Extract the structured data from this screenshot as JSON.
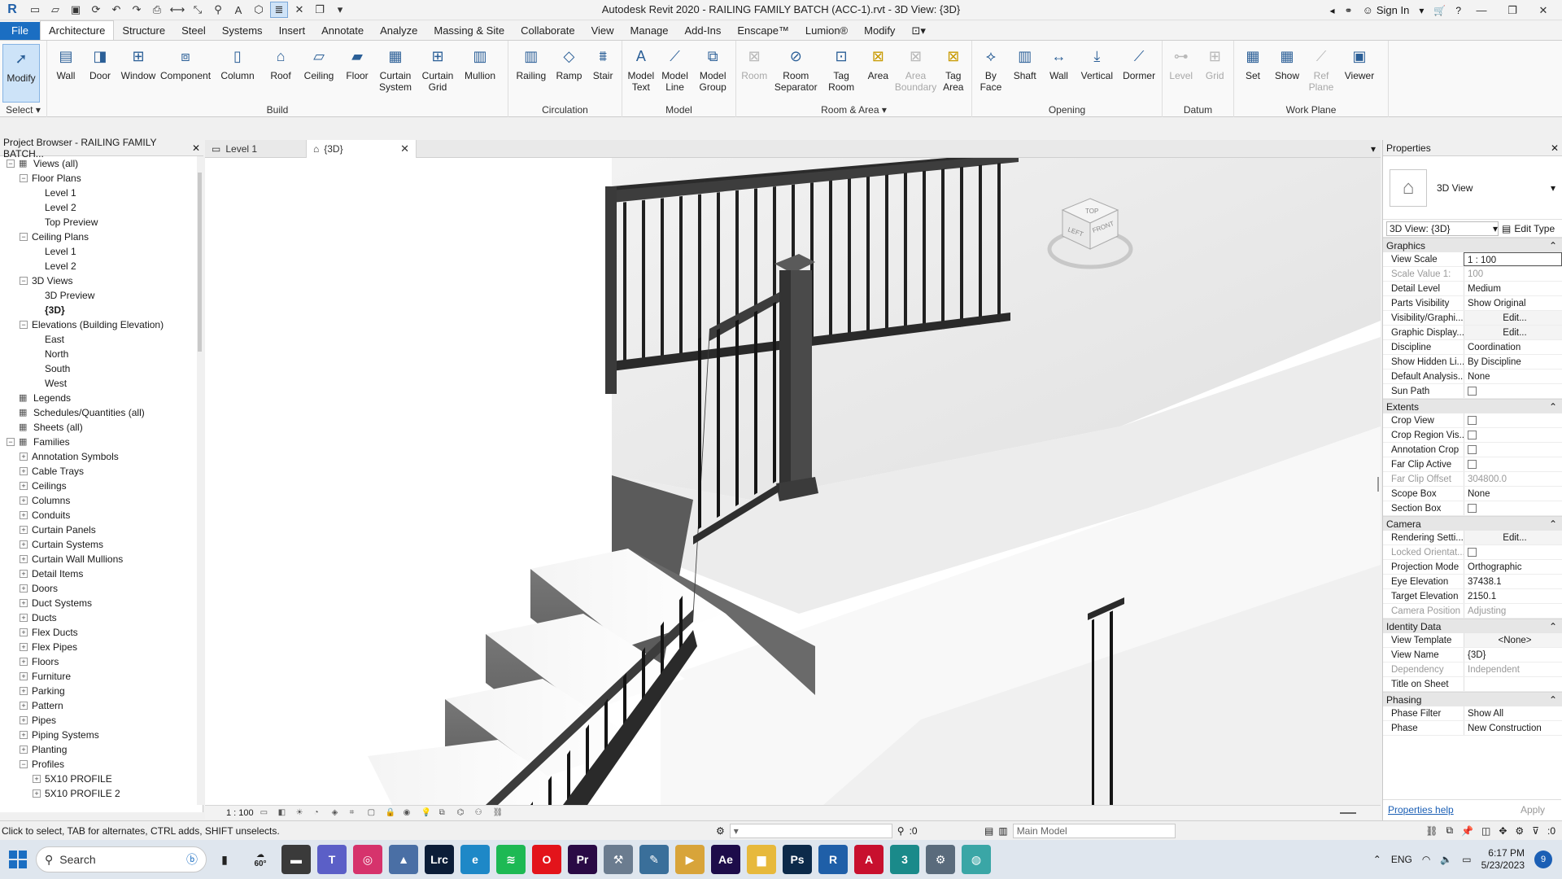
{
  "app": {
    "title": "Autodesk Revit 2020 - RAILING FAMILY BATCH (ACC-1).rvt - 3D View: {3D}",
    "sign_in": "Sign In"
  },
  "ribbon_tabs": [
    "File",
    "Architecture",
    "Structure",
    "Steel",
    "Systems",
    "Insert",
    "Annotate",
    "Analyze",
    "Massing & Site",
    "Collaborate",
    "View",
    "Manage",
    "Add-Ins",
    "Enscape™",
    "Lumion®",
    "Modify"
  ],
  "ribbon": {
    "select": {
      "modify": "Modify",
      "title": "Select"
    },
    "build": {
      "title": "Build",
      "buttons": [
        "Wall",
        "Door",
        "Window",
        "Component",
        "Column",
        "Roof",
        "Ceiling",
        "Floor",
        "Curtain System",
        "Curtain Grid",
        "Mullion"
      ]
    },
    "circulation": {
      "title": "Circulation",
      "buttons": [
        "Railing",
        "Ramp",
        "Stair"
      ]
    },
    "model": {
      "title": "Model",
      "buttons": [
        "Model Text",
        "Model Line",
        "Model Group"
      ]
    },
    "room_area": {
      "title": "Room & Area",
      "buttons": [
        "Room",
        "Room Separator",
        "Tag Room",
        "Area",
        "Area Boundary",
        "Tag Area"
      ]
    },
    "opening": {
      "title": "Opening",
      "buttons": [
        "By Face",
        "Shaft",
        "Wall",
        "Vertical",
        "Dormer"
      ]
    },
    "datum": {
      "title": "Datum",
      "buttons": [
        "Level",
        "Grid"
      ]
    },
    "work_plane": {
      "title": "Work Plane",
      "buttons": [
        "Set",
        "Show",
        "Ref Plane",
        "Viewer"
      ]
    }
  },
  "project_browser": {
    "title": "Project Browser - RAILING FAMILY BATCH...",
    "tree": [
      {
        "label": "Views (all)",
        "level": 0,
        "exp": "−",
        "icon": "view-icon"
      },
      {
        "label": "Floor Plans",
        "level": 1,
        "exp": "−"
      },
      {
        "label": "Level 1",
        "level": 2,
        "exp": ""
      },
      {
        "label": "Level 2",
        "level": 2,
        "exp": ""
      },
      {
        "label": "Top Preview",
        "level": 2,
        "exp": ""
      },
      {
        "label": "Ceiling Plans",
        "level": 1,
        "exp": "−"
      },
      {
        "label": "Level 1",
        "level": 2,
        "exp": ""
      },
      {
        "label": "Level 2",
        "level": 2,
        "exp": ""
      },
      {
        "label": "3D Views",
        "level": 1,
        "exp": "−"
      },
      {
        "label": "3D Preview",
        "level": 2,
        "exp": ""
      },
      {
        "label": "{3D}",
        "level": 2,
        "exp": "",
        "bold": true
      },
      {
        "label": "Elevations (Building Elevation)",
        "level": 1,
        "exp": "−"
      },
      {
        "label": "East",
        "level": 2,
        "exp": ""
      },
      {
        "label": "North",
        "level": 2,
        "exp": ""
      },
      {
        "label": "South",
        "level": 2,
        "exp": ""
      },
      {
        "label": "West",
        "level": 2,
        "exp": ""
      },
      {
        "label": "Legends",
        "level": 0,
        "exp": "",
        "icon": "legend-icon"
      },
      {
        "label": "Schedules/Quantities (all)",
        "level": 0,
        "exp": "",
        "icon": "schedule-icon"
      },
      {
        "label": "Sheets (all)",
        "level": 0,
        "exp": "",
        "icon": "sheet-icon"
      },
      {
        "label": "Families",
        "level": 0,
        "exp": "−",
        "icon": "family-icon"
      },
      {
        "label": "Annotation Symbols",
        "level": 1,
        "exp": "+"
      },
      {
        "label": "Cable Trays",
        "level": 1,
        "exp": "+"
      },
      {
        "label": "Ceilings",
        "level": 1,
        "exp": "+"
      },
      {
        "label": "Columns",
        "level": 1,
        "exp": "+"
      },
      {
        "label": "Conduits",
        "level": 1,
        "exp": "+"
      },
      {
        "label": "Curtain Panels",
        "level": 1,
        "exp": "+"
      },
      {
        "label": "Curtain Systems",
        "level": 1,
        "exp": "+"
      },
      {
        "label": "Curtain Wall Mullions",
        "level": 1,
        "exp": "+"
      },
      {
        "label": "Detail Items",
        "level": 1,
        "exp": "+"
      },
      {
        "label": "Doors",
        "level": 1,
        "exp": "+"
      },
      {
        "label": "Duct Systems",
        "level": 1,
        "exp": "+"
      },
      {
        "label": "Ducts",
        "level": 1,
        "exp": "+"
      },
      {
        "label": "Flex Ducts",
        "level": 1,
        "exp": "+"
      },
      {
        "label": "Flex Pipes",
        "level": 1,
        "exp": "+"
      },
      {
        "label": "Floors",
        "level": 1,
        "exp": "+"
      },
      {
        "label": "Furniture",
        "level": 1,
        "exp": "+"
      },
      {
        "label": "Parking",
        "level": 1,
        "exp": "+"
      },
      {
        "label": "Pattern",
        "level": 1,
        "exp": "+"
      },
      {
        "label": "Pipes",
        "level": 1,
        "exp": "+"
      },
      {
        "label": "Piping Systems",
        "level": 1,
        "exp": "+"
      },
      {
        "label": "Planting",
        "level": 1,
        "exp": "+"
      },
      {
        "label": "Profiles",
        "level": 1,
        "exp": "−"
      },
      {
        "label": "5X10 PROFILE",
        "level": 2,
        "exp": "+"
      },
      {
        "label": "5X10 PROFILE 2",
        "level": 2,
        "exp": "+"
      }
    ]
  },
  "view_tabs": [
    {
      "label": "Level 1",
      "icon": "floor-plan-icon",
      "active": false
    },
    {
      "label": "{3D}",
      "icon": "3d-view-icon",
      "active": true
    }
  ],
  "view_bar": {
    "scale": "1 : 100"
  },
  "view_cube": {
    "top": "TOP",
    "left": "LEFT",
    "front": "FRONT"
  },
  "properties": {
    "title": "Properties",
    "type_name": "3D View",
    "selector": "3D View: {3D}",
    "edit_type": "Edit Type",
    "groups": [
      {
        "name": "Graphics",
        "rows": [
          {
            "k": "View Scale",
            "v": "1 : 100",
            "style": "boxed"
          },
          {
            "k": "Scale Value    1:",
            "v": "100",
            "dim": true
          },
          {
            "k": "Detail Level",
            "v": "Medium"
          },
          {
            "k": "Parts Visibility",
            "v": "Show Original"
          },
          {
            "k": "Visibility/Graphi...",
            "v": "Edit...",
            "style": "btn"
          },
          {
            "k": "Graphic Display...",
            "v": "Edit...",
            "style": "btn"
          },
          {
            "k": "Discipline",
            "v": "Coordination"
          },
          {
            "k": "Show Hidden Li...",
            "v": "By Discipline"
          },
          {
            "k": "Default Analysis...",
            "v": "None"
          },
          {
            "k": "Sun Path",
            "v": "",
            "style": "check"
          }
        ]
      },
      {
        "name": "Extents",
        "rows": [
          {
            "k": "Crop View",
            "v": "",
            "style": "check"
          },
          {
            "k": "Crop Region Vis...",
            "v": "",
            "style": "check"
          },
          {
            "k": "Annotation Crop",
            "v": "",
            "style": "check"
          },
          {
            "k": "Far Clip Active",
            "v": "",
            "style": "check"
          },
          {
            "k": "Far Clip Offset",
            "v": "304800.0",
            "dim": true
          },
          {
            "k": "Scope Box",
            "v": "None"
          },
          {
            "k": "Section Box",
            "v": "",
            "style": "check"
          }
        ]
      },
      {
        "name": "Camera",
        "rows": [
          {
            "k": "Rendering Setti...",
            "v": "Edit...",
            "style": "btn"
          },
          {
            "k": "Locked Orientat...",
            "v": "",
            "style": "check",
            "dim": true
          },
          {
            "k": "Projection Mode",
            "v": "Orthographic"
          },
          {
            "k": "Eye Elevation",
            "v": "37438.1"
          },
          {
            "k": "Target Elevation",
            "v": "2150.1"
          },
          {
            "k": "Camera Position",
            "v": "Adjusting",
            "dim": true
          }
        ]
      },
      {
        "name": "Identity Data",
        "rows": [
          {
            "k": "View Template",
            "v": "<None>",
            "style": "btn"
          },
          {
            "k": "View Name",
            "v": "{3D}"
          },
          {
            "k": "Dependency",
            "v": "Independent",
            "dim": true
          },
          {
            "k": "Title on Sheet",
            "v": ""
          }
        ]
      },
      {
        "name": "Phasing",
        "rows": [
          {
            "k": "Phase Filter",
            "v": "Show All"
          },
          {
            "k": "Phase",
            "v": "New Construction"
          }
        ]
      }
    ],
    "help": "Properties help",
    "apply": "Apply"
  },
  "status": {
    "message": "Click to select, TAB for alternates, CTRL adds, SHIFT unselects.",
    "selection_count": ":0",
    "model": "Main Model",
    "filter_count": ":0"
  },
  "taskbar": {
    "search_placeholder": "Search",
    "weather": "60°",
    "lang": "ENG",
    "time": "6:17 PM",
    "date": "5/23/2023",
    "notifications": "9",
    "apps": [
      {
        "name": "file-explorer-app",
        "color": "#3a3a3a",
        "glyph": "▬"
      },
      {
        "name": "teams-app",
        "color": "#5b5fc7",
        "glyph": "T"
      },
      {
        "name": "instagram-app",
        "color": "#d6336c",
        "glyph": "◎"
      },
      {
        "name": "chart-app",
        "color": "#4a6fa5",
        "glyph": "▲"
      },
      {
        "name": "lightroom-app",
        "color": "#0b1d38",
        "glyph": "Lrc"
      },
      {
        "name": "edge-app",
        "color": "#1e88c7",
        "glyph": "e"
      },
      {
        "name": "spotify-app",
        "color": "#1db954",
        "glyph": "≋"
      },
      {
        "name": "opera-app",
        "color": "#e3141b",
        "glyph": "O"
      },
      {
        "name": "premiere-app",
        "color": "#2a0a45",
        "glyph": "Pr"
      },
      {
        "name": "tool-app",
        "color": "#6b7c8f",
        "glyph": "⚒"
      },
      {
        "name": "autocad-app",
        "color": "#3a6f9a",
        "glyph": "✎"
      },
      {
        "name": "media-app",
        "color": "#d8a43a",
        "glyph": "▶"
      },
      {
        "name": "after-effects-app",
        "color": "#1d0c4a",
        "glyph": "Ae"
      },
      {
        "name": "folder-app",
        "color": "#e7b93c",
        "glyph": "▆"
      },
      {
        "name": "photoshop-app",
        "color": "#0c2a4a",
        "glyph": "Ps"
      },
      {
        "name": "revit-app",
        "color": "#1f5fa8",
        "glyph": "R"
      },
      {
        "name": "autocad-red-app",
        "color": "#c8102e",
        "glyph": "A"
      },
      {
        "name": "3dsmax-app",
        "color": "#1a8a8a",
        "glyph": "3"
      },
      {
        "name": "settings-app",
        "color": "#5a6b7c",
        "glyph": "⚙"
      },
      {
        "name": "globe-app",
        "color": "#3aa6a6",
        "glyph": "◍"
      }
    ]
  },
  "colors": {
    "accent": "#1b6ec2",
    "viewport_bg": "#ffffff",
    "railing_dark": "#3d3d3d"
  }
}
